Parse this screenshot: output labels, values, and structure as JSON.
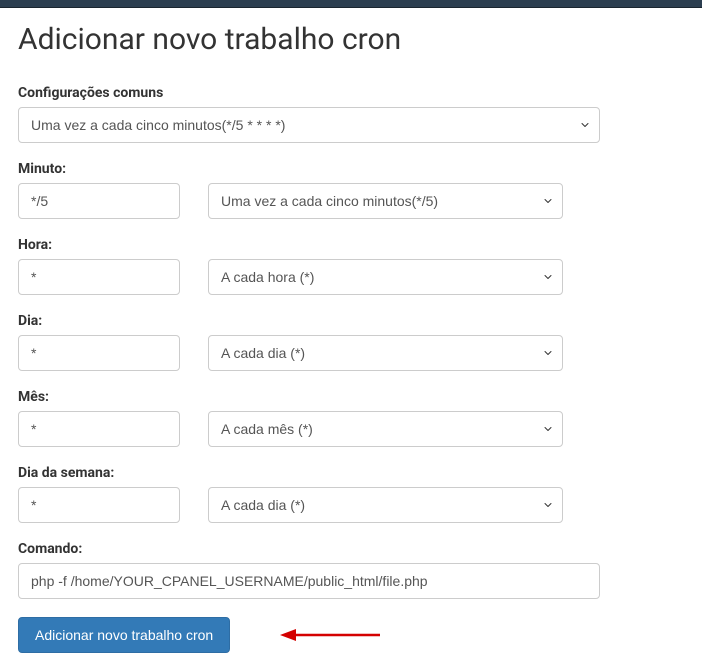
{
  "title": "Adicionar novo trabalho cron",
  "commonSettings": {
    "label": "Configurações comuns",
    "selected": "Uma vez a cada cinco minutos(*/5 * * * *)"
  },
  "minute": {
    "label": "Minuto:",
    "value": "*/5",
    "selected": "Uma vez a cada cinco minutos(*/5)"
  },
  "hour": {
    "label": "Hora:",
    "value": "*",
    "selected": "A cada hora (*)"
  },
  "day": {
    "label": "Dia:",
    "value": "*",
    "selected": "A cada dia (*)"
  },
  "month": {
    "label": "Mês:",
    "value": "*",
    "selected": "A cada mês (*)"
  },
  "weekday": {
    "label": "Dia da semana:",
    "value": "*",
    "selected": "A cada dia (*)"
  },
  "command": {
    "label": "Comando:",
    "value": "php -f /home/YOUR_CPANEL_USERNAME/public_html/file.php"
  },
  "submitButton": "Adicionar novo trabalho cron"
}
